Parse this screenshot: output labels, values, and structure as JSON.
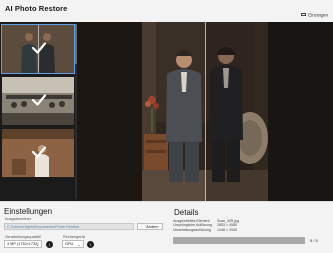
{
  "app": {
    "title": "AI Photo Restore"
  },
  "toolbar": {
    "minimize_label": "Einzeigen"
  },
  "thumbnails": [
    {
      "name": "thumb-1",
      "selected": true,
      "done": true
    },
    {
      "name": "thumb-2",
      "selected": false,
      "done": true
    },
    {
      "name": "thumb-3",
      "selected": false,
      "done": true
    }
  ],
  "settings": {
    "heading": "Einstellungen",
    "output_label": "Ausgabeordner",
    "output_path": "C:\\Users\\Objekt\\Documents\\Photo Restore",
    "change_button": "Ändern",
    "quality_label": "Verarbeitungsqualität",
    "quality_value": "3 MP (1732×1732)",
    "device_label": "Rechengerät",
    "device_value": "GPU"
  },
  "details": {
    "heading": "Details",
    "rows": [
      {
        "key": "Ausgewähltes Element",
        "value": "Scan_005.jpg"
      },
      {
        "key": "Ursprüngliche Auflösung",
        "value": "2653 × 4080"
      },
      {
        "key": "Verarbeitungsauflösung",
        "value": "1448 × 2000"
      }
    ],
    "progress_fraction": 1.0,
    "progress_text": "5 / 5"
  },
  "colors": {
    "accent": "#5fa0e8",
    "viewer_bg": "#141414"
  }
}
